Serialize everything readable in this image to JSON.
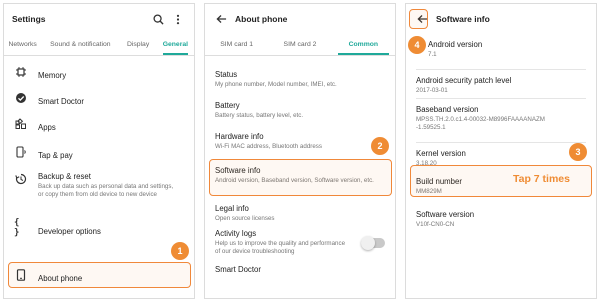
{
  "panel1": {
    "title": "Settings",
    "tabs": [
      "Networks",
      "Sound & notification",
      "Display",
      "General"
    ],
    "items": [
      {
        "label": "Memory",
        "icon": "memory-icon"
      },
      {
        "label": "Smart Doctor",
        "icon": "smart-doctor-icon"
      },
      {
        "label": "Apps",
        "icon": "apps-icon"
      },
      {
        "label": "Tap & pay",
        "icon": "tap-pay-icon"
      },
      {
        "label": "Backup & reset",
        "sub": "Back up data such as personal data and settings, or copy them from old device to new device",
        "icon": "backup-icon"
      },
      {
        "label": "Developer options",
        "icon": "developer-icon"
      },
      {
        "label": "About phone",
        "icon": "about-phone-icon"
      }
    ],
    "step": "1"
  },
  "panel2": {
    "title": "About phone",
    "tabs": [
      "SIM card 1",
      "SIM card 2",
      "Common"
    ],
    "items": [
      {
        "label": "Status",
        "sub": "My phone number, Model number, IMEI, etc."
      },
      {
        "label": "Battery",
        "sub": "Battery status, battery level, etc."
      },
      {
        "label": "Hardware info",
        "sub": "Wi-Fi MAC address, Bluetooth address"
      },
      {
        "label": "Software info",
        "sub": "Android version, Baseband version, Software version, etc."
      },
      {
        "label": "Legal info",
        "sub": "Open source licenses"
      },
      {
        "label": "Activity logs",
        "sub": "Help us to improve the quality and performance of our device troubleshooting"
      },
      {
        "label": "Smart Doctor",
        "sub": ""
      }
    ],
    "step": "2"
  },
  "panel3": {
    "title": "Software info",
    "items": [
      {
        "label": "Android version",
        "value": "7.1"
      },
      {
        "label": "Android security patch level",
        "value": "2017-03-01"
      },
      {
        "label": "Baseband version",
        "value": "MPSS.TH.2.0.c1.4-00032-M8996FAAAANAZM-1.59525.1"
      },
      {
        "label": "Kernel version",
        "value": "3.18.20"
      },
      {
        "label": "Build number",
        "value": "MM829M"
      },
      {
        "label": "Software version",
        "value": "V10f-CN0-CN"
      }
    ],
    "step_back": "4",
    "step_build": "3",
    "tap_text": "Tap 7 times"
  },
  "colors": {
    "accent": "#1fa99a",
    "highlight": "#f0883a",
    "badge": "#ef8c34"
  }
}
